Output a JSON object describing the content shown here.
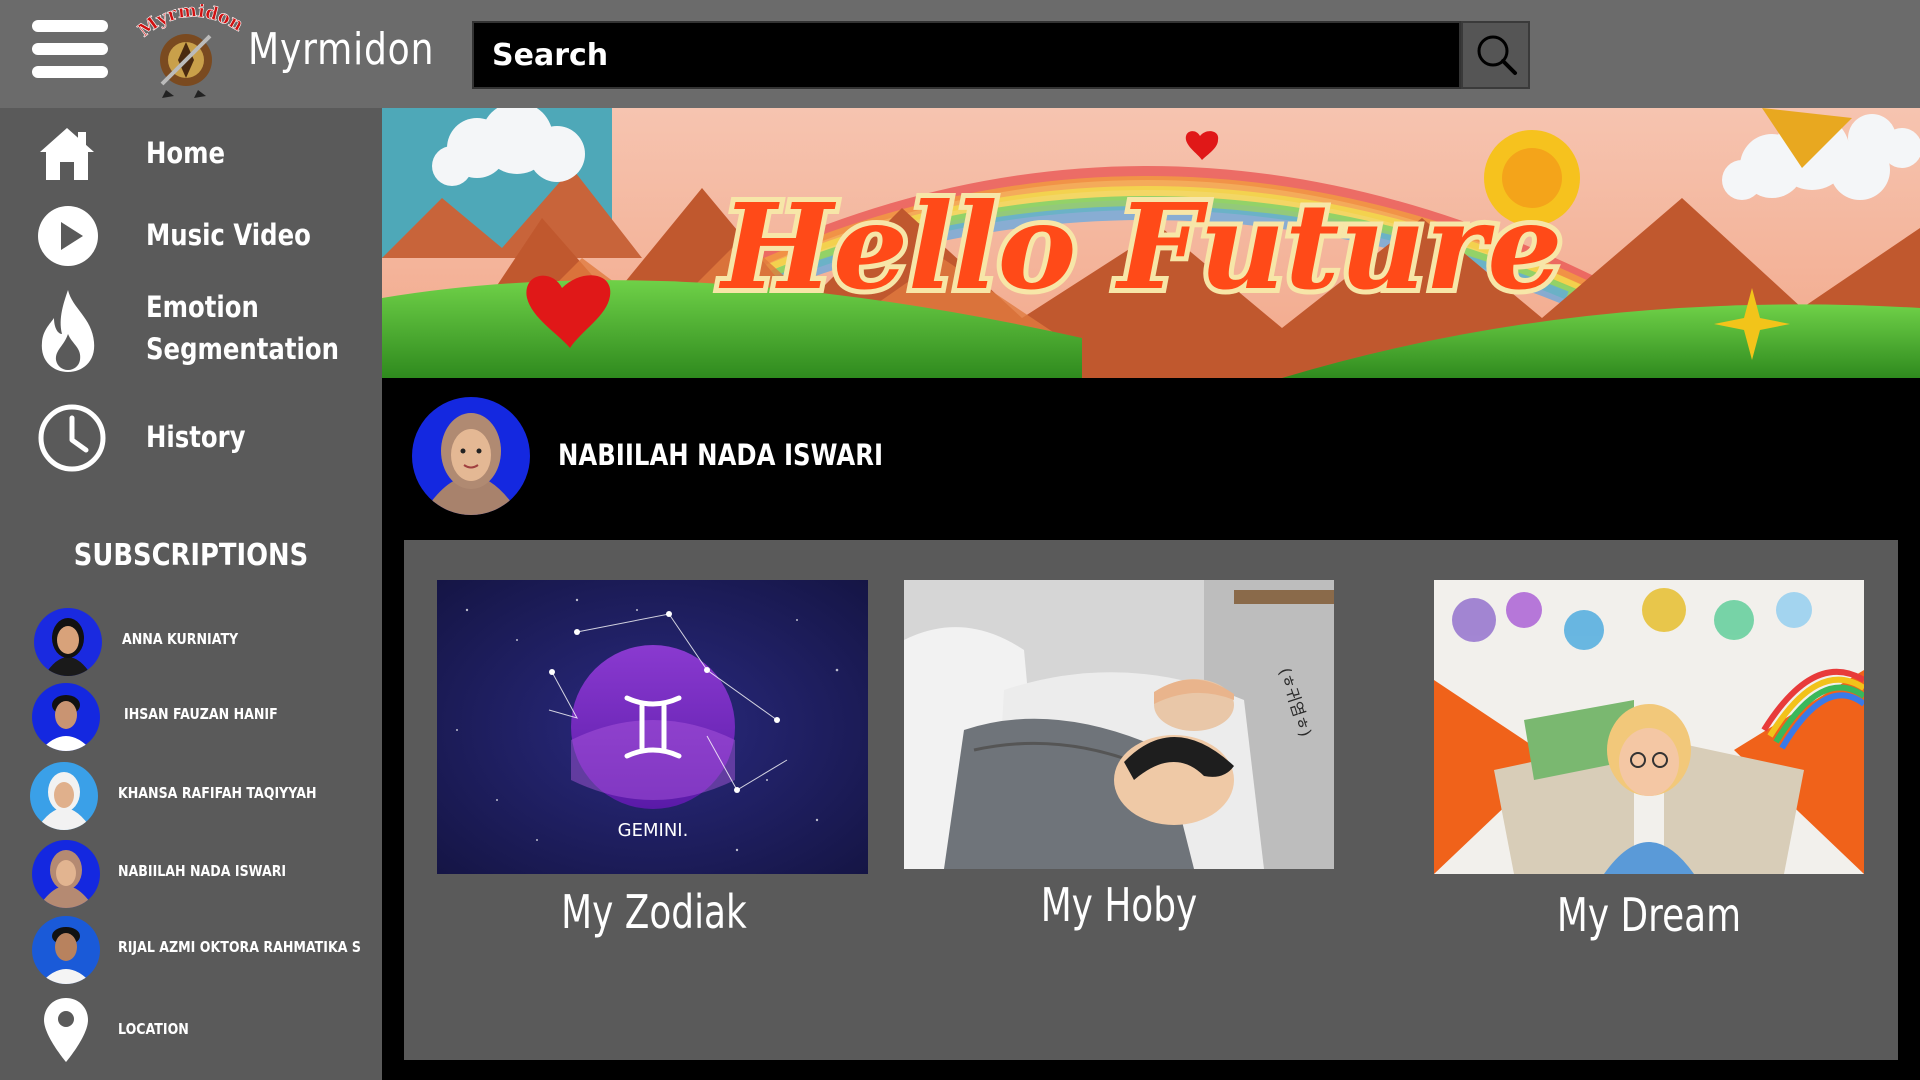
{
  "app": {
    "title": "Myrmidon",
    "logo_text": "Myrmidon"
  },
  "search": {
    "placeholder": "Search"
  },
  "sidebar": {
    "items": [
      {
        "label": "Home",
        "icon": "home-icon"
      },
      {
        "label": "Music Video",
        "icon": "play-icon"
      },
      {
        "label": "Emotion\nSegmentation",
        "label_line1": "Emotion",
        "label_line2": "Segmentation",
        "icon": "fire-icon"
      },
      {
        "label": "History",
        "icon": "clock-icon"
      }
    ],
    "subscriptions_heading": "SUBSCRIPTIONS",
    "subscriptions": [
      {
        "name": "ANNA KURNIATY"
      },
      {
        "name": "IHSAN FAUZAN HANIF"
      },
      {
        "name": "KHANSA RAFIFAH TAQIYYAH"
      },
      {
        "name": "NABIILAH NADA ISWARI"
      },
      {
        "name": "RIJAL AZMI OKTORA RAHMATIKA S"
      }
    ],
    "location": {
      "label": "LOCATION",
      "icon": "location-pin-icon"
    }
  },
  "banner": {
    "text": "Hello Future"
  },
  "profile": {
    "name": "NABIILAH NADA ISWARI"
  },
  "cards": [
    {
      "title": "My Zodiak",
      "thumb_caption": "GEMINI."
    },
    {
      "title": "My Hoby",
      "thumb_caption": "(ㅎ귀염ㅎ)"
    },
    {
      "title": "My Dream"
    }
  ],
  "colors": {
    "topbar": "#6b6b6b",
    "sidebar": "#5a5a5a",
    "panel": "#5a5a5a",
    "background": "#000000",
    "avatar_blue": "#1428e0"
  }
}
